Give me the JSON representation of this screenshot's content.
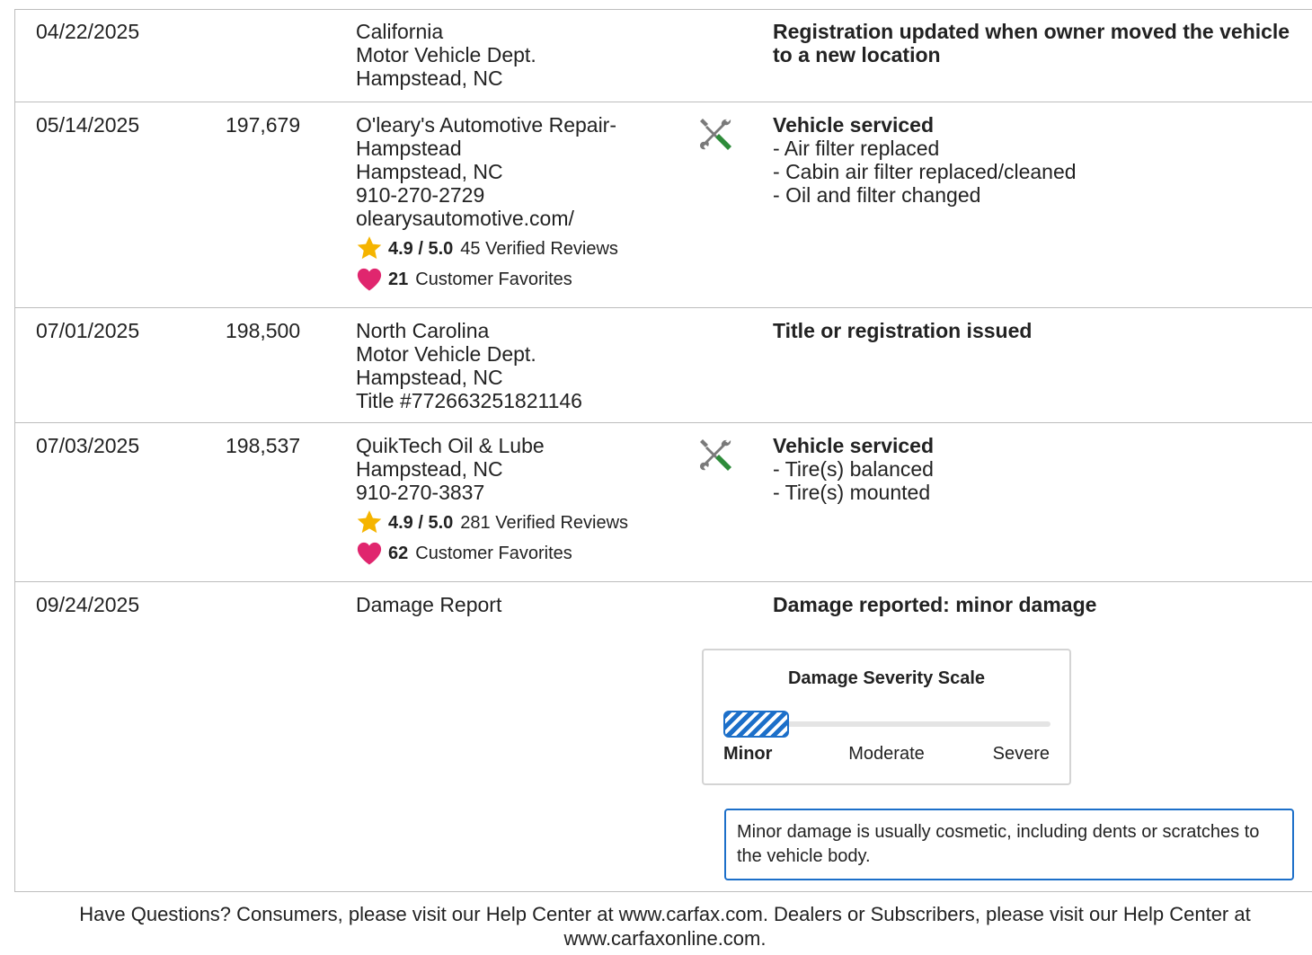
{
  "records": [
    {
      "date": "04/22/2025",
      "odometer": "",
      "source_lines": [
        "California",
        "Motor Vehicle Dept.",
        "Hampstead, NC"
      ],
      "heading_lines": [
        "Registration updated when owner moved the vehicle",
        "to a new location"
      ],
      "items": []
    },
    {
      "date": "05/14/2025",
      "odometer": "197,679",
      "source_lines": [
        "O'leary's Automotive Repair-",
        "Hampstead",
        "Hampstead, NC",
        "910-270-2729",
        "olearysautomotive.com/"
      ],
      "rating": {
        "score": "4.9 / 5.0",
        "reviews": "45 Verified Reviews"
      },
      "favorites": {
        "count": "21",
        "label": "Customer Favorites"
      },
      "icon": "wrench-screwdriver-icon",
      "heading_lines": [
        "Vehicle serviced"
      ],
      "items": [
        "Air filter replaced",
        "Cabin air filter replaced/cleaned",
        "Oil and filter changed"
      ]
    },
    {
      "date": "07/01/2025",
      "odometer": "198,500",
      "source_lines": [
        "North Carolina",
        "Motor Vehicle Dept.",
        "Hampstead, NC",
        "Title #772663251821146"
      ],
      "heading_lines": [
        "Title or registration issued"
      ],
      "items": []
    },
    {
      "date": "07/03/2025",
      "odometer": "198,537",
      "source_lines": [
        "QuikTech Oil & Lube",
        "Hampstead, NC",
        "910-270-3837"
      ],
      "rating": {
        "score": "4.9 / 5.0",
        "reviews": "281 Verified Reviews"
      },
      "favorites": {
        "count": "62",
        "label": "Customer Favorites"
      },
      "icon": "wrench-screwdriver-icon",
      "heading_lines": [
        "Vehicle serviced"
      ],
      "items": [
        "Tire(s) balanced",
        "Tire(s) mounted"
      ]
    },
    {
      "date": "09/24/2025",
      "odometer": "",
      "source_lines": [
        "Damage Report"
      ],
      "heading_lines": [
        "Damage reported: minor damage"
      ],
      "items": []
    }
  ],
  "damage_scale": {
    "title": "Damage Severity Scale",
    "levels": [
      "Minor",
      "Moderate",
      "Severe"
    ],
    "selected_level": "Minor",
    "fill_fraction": 0.2
  },
  "damage_note": "Minor damage is usually cosmetic, including dents or scratches to the vehicle body.",
  "footer": {
    "line1": "Have Questions? Consumers, please visit our Help Center at www.carfax.com. Dealers or Subscribers, please visit our Help Center at",
    "line2": "www.carfaxonline.com."
  },
  "colors": {
    "border": "#bdbdbd",
    "text": "#222222",
    "accent_blue": "#1c6fc9",
    "star": "#f5b400",
    "heart": "#e0266e",
    "wrench_green": "#2e8b3a",
    "wrench_gray": "#7a7a7a"
  }
}
